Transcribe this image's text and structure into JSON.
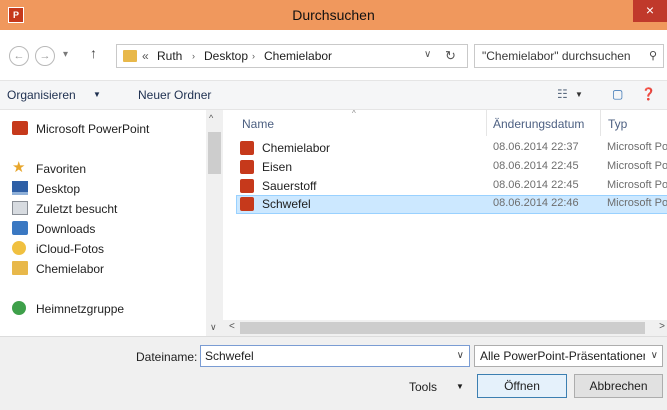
{
  "window": {
    "title": "Durchsuchen",
    "app_icon_text": "P",
    "close_glyph": "×"
  },
  "navigation": {
    "back_glyph": "←",
    "forward_glyph": "→",
    "history_glyph": "▾",
    "up_glyph": "↑",
    "overflow_glyph": "«",
    "breadcrumb": [
      "Ruth",
      "Desktop",
      "Chemielabor"
    ],
    "separator_glyph": "›",
    "dropdown_glyph": "∨",
    "refresh_glyph": "↻",
    "search_placeholder": "\"Chemielabor\" durchsuchen",
    "search_glyph": "⚲"
  },
  "toolbar": {
    "organize_label": "Organisieren",
    "organize_arrow": "▼",
    "new_folder_label": "Neuer Ordner",
    "view_glyph": "☷",
    "view_arrow": "▼",
    "preview_glyph": "▢",
    "help_glyph": "❓"
  },
  "sidebar": {
    "items": [
      {
        "label": "Microsoft PowerPoint",
        "icon": "powerpoint-icon"
      },
      {
        "label": "Favoriten",
        "icon": "star-icon"
      },
      {
        "label": "Desktop",
        "icon": "desktop-icon"
      },
      {
        "label": "Zuletzt besucht",
        "icon": "recent-places-icon"
      },
      {
        "label": "Downloads",
        "icon": "downloads-icon"
      },
      {
        "label": "iCloud-Fotos",
        "icon": "icloud-icon"
      },
      {
        "label": "Chemielabor",
        "icon": "folder-icon"
      },
      {
        "label": "Heimnetzgruppe",
        "icon": "homegroup-icon"
      }
    ],
    "star_glyph": "★"
  },
  "file_list": {
    "columns": [
      "Name",
      "Änderungsdatum",
      "Typ"
    ],
    "sort_glyph": "^",
    "rows": [
      {
        "name": "Chemielabor",
        "date": "08.06.2014 22:37",
        "type": "Microsoft PowerPoint",
        "selected": false
      },
      {
        "name": "Eisen",
        "date": "08.06.2014 22:45",
        "type": "Microsoft PowerPoint",
        "selected": false
      },
      {
        "name": "Sauerstoff",
        "date": "08.06.2014 22:45",
        "type": "Microsoft PowerPoint",
        "selected": false
      },
      {
        "name": "Schwefel",
        "date": "08.06.2014 22:46",
        "type": "Microsoft PowerPoint",
        "selected": true
      }
    ]
  },
  "scrollbars": {
    "up_glyph": "^",
    "down_glyph": "∨",
    "left_glyph": "<",
    "right_glyph": ">"
  },
  "footer": {
    "filename_label": "Dateiname:",
    "filename_value": "Schwefel",
    "filename_dropdown_glyph": "∨",
    "filetype_value": "Alle PowerPoint-Präsentationen",
    "filetype_dropdown_glyph": "∨",
    "tools_label": "Tools",
    "tools_arrow": "▼",
    "open_label": "Öffnen",
    "cancel_label": "Abbrechen"
  },
  "colors": {
    "titlebar": "#f0985d",
    "close_button": "#c0392b",
    "selection": "#cce8ff",
    "powerpoint": "#c6391b"
  }
}
